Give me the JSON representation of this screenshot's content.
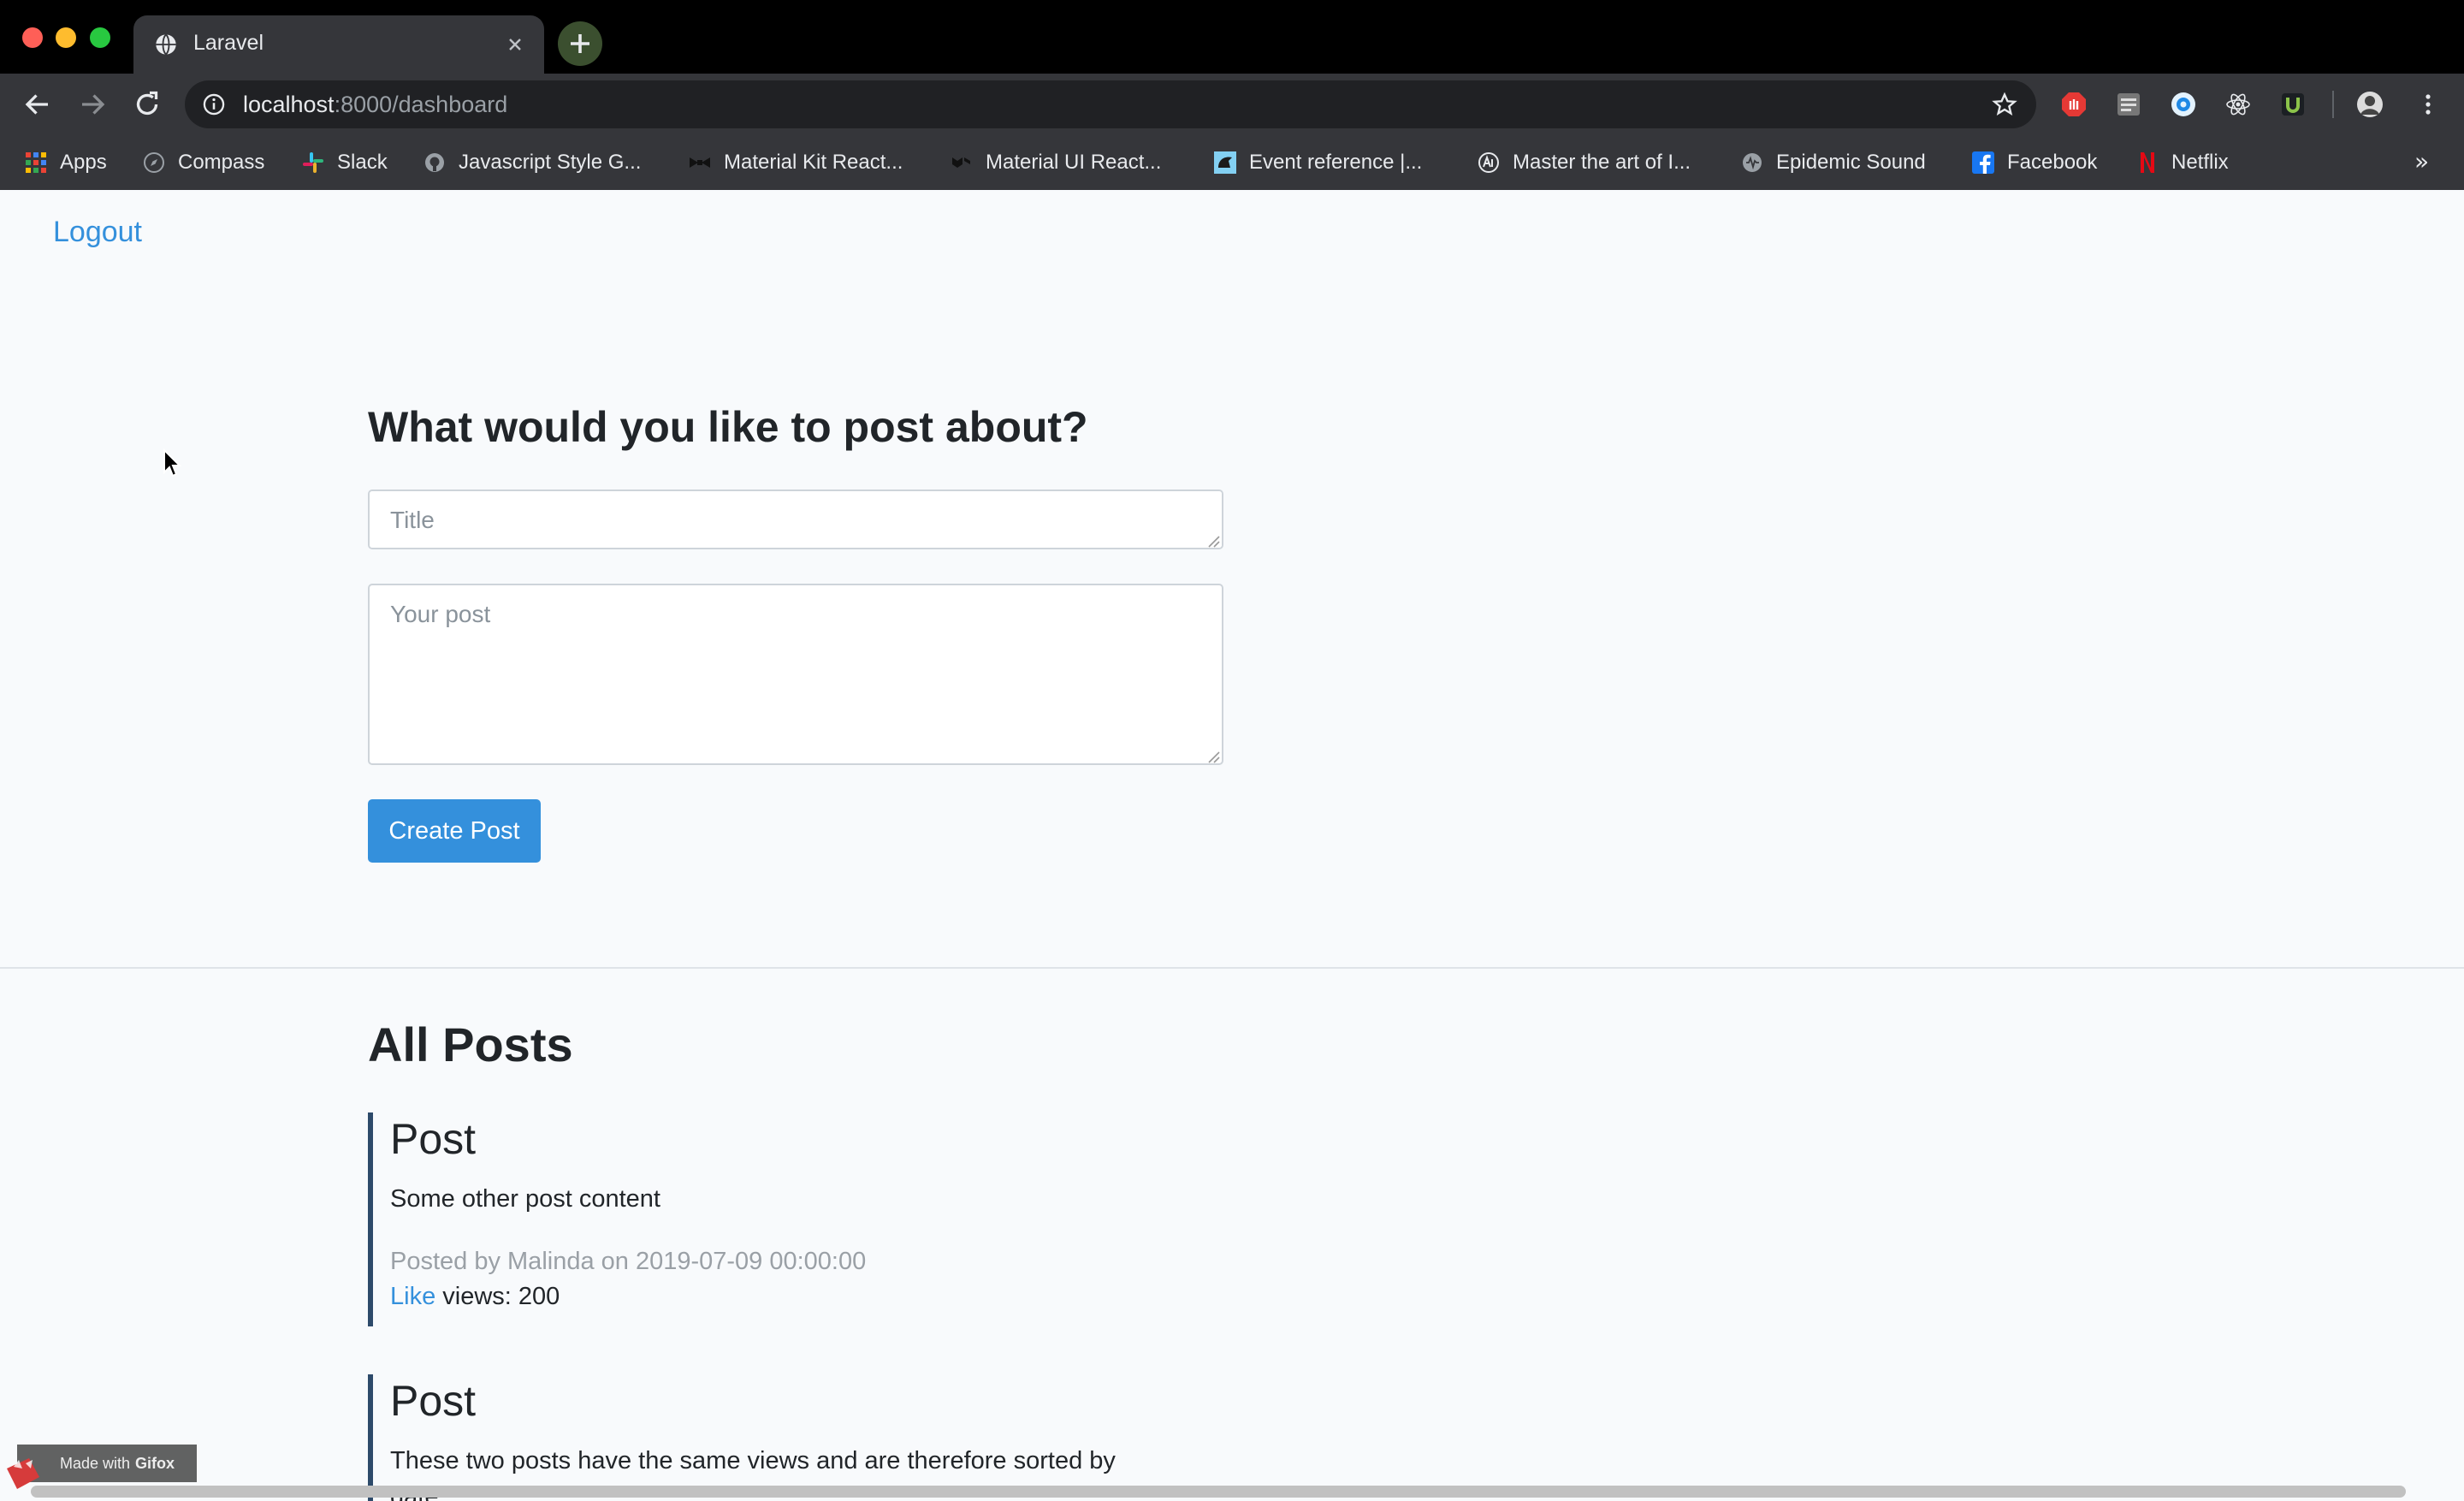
{
  "browser": {
    "tab_title": "Laravel",
    "url_host": "localhost",
    "url_rest": ":8000/dashboard",
    "bookmarks": [
      {
        "label": "Apps",
        "icon": "apps-grid-icon"
      },
      {
        "label": "Compass",
        "icon": "compass-icon"
      },
      {
        "label": "Slack",
        "icon": "slack-icon"
      },
      {
        "label": "Javascript Style G...",
        "icon": "github-icon"
      },
      {
        "label": "Material Kit React...",
        "icon": "bowtie-icon"
      },
      {
        "label": "Material UI React...",
        "icon": "material-ui-icon"
      },
      {
        "label": "Event reference |...",
        "icon": "mdn-icon"
      },
      {
        "label": "Master the art of I...",
        "icon": "frontend-masters-icon"
      },
      {
        "label": "Epidemic Sound",
        "icon": "epidemic-sound-icon"
      },
      {
        "label": "Facebook",
        "icon": "facebook-icon"
      },
      {
        "label": "Netflix",
        "icon": "netflix-icon"
      }
    ],
    "more_bookmarks": "»"
  },
  "nav": {
    "logout_label": "Logout"
  },
  "form": {
    "heading": "What would you like to post about?",
    "title_placeholder": "Title",
    "body_placeholder": "Your post",
    "submit_label": "Create Post"
  },
  "posts": {
    "heading": "All Posts",
    "items": [
      {
        "title": "Post",
        "body": "Some other post content",
        "meta": "Posted by Malinda on 2019-07-09 00:00:00",
        "like_label": "Like",
        "views": "views: 200"
      },
      {
        "title": "Post",
        "body": "These two posts have the same views and are therefore sorted by date"
      }
    ]
  },
  "overlay": {
    "gifox_text": "Made with",
    "gifox_brand": "Gifox"
  },
  "colors": {
    "accent": "#3490dc",
    "post_border": "#2d4a6a",
    "page_bg": "#f8fafc"
  }
}
